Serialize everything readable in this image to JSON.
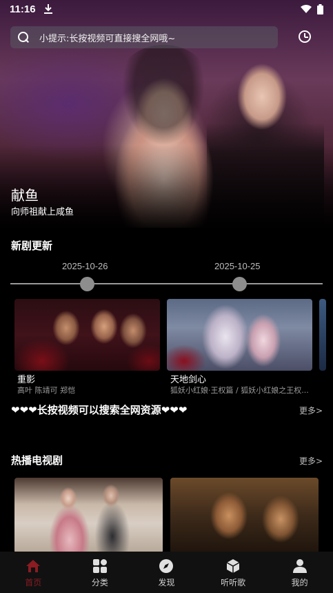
{
  "status_bar": {
    "time": "11:16"
  },
  "search": {
    "placeholder_text": "小提示:长按视频可直接搜全网哦~"
  },
  "hero": {
    "title": "献鱼",
    "subtitle": "向师祖献上咸鱼"
  },
  "new_episodes": {
    "section_title": "新剧更新",
    "timeline_dates": [
      "2025-10-26",
      "2025-10-25"
    ],
    "cards": [
      {
        "title": "重影",
        "cast": "高叶 陈靖可 郑恺"
      },
      {
        "title": "天地剑心",
        "cast": "狐妖小红娘·王权篇 / 狐妖小红娘之王权..."
      }
    ]
  },
  "promo": {
    "text": "❤❤❤长按视频可以搜索全网资源❤❤❤",
    "more_label": "更多>"
  },
  "hot_tv": {
    "section_title": "热播电视剧",
    "more_label": "更多>"
  },
  "bottom_nav": {
    "items": [
      {
        "label": "首页",
        "icon": "home-icon",
        "active": true
      },
      {
        "label": "分类",
        "icon": "category-icon",
        "active": false
      },
      {
        "label": "发现",
        "icon": "compass-icon",
        "active": false
      },
      {
        "label": "听听歌",
        "icon": "music-box-icon",
        "active": false
      },
      {
        "label": "我的",
        "icon": "user-icon",
        "active": false
      }
    ]
  },
  "colors": {
    "active_nav": "#8a1c22",
    "background": "#000000",
    "timeline_dot": "#8d8d8d"
  }
}
